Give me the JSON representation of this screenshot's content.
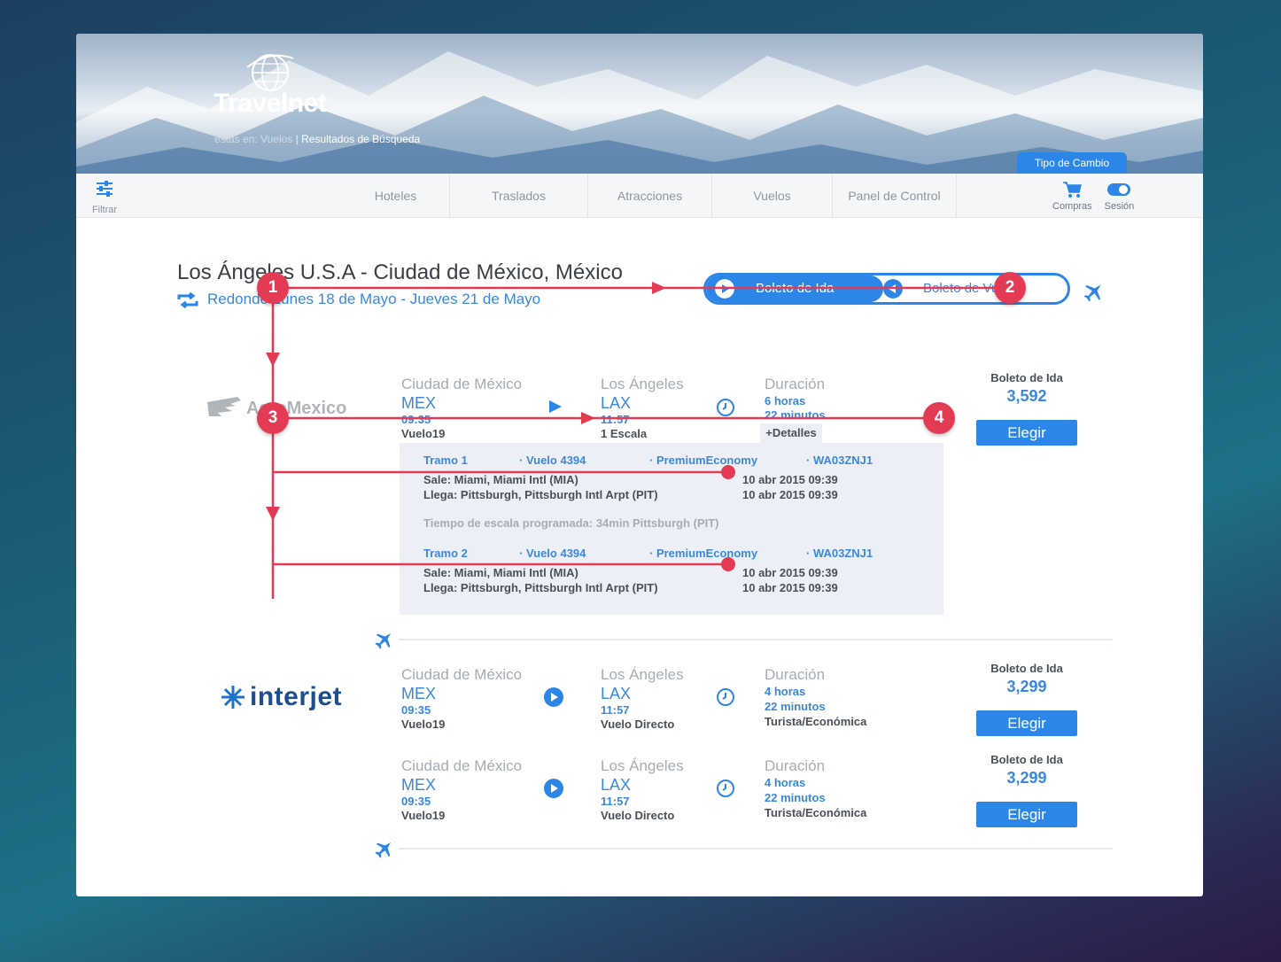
{
  "brand": {
    "name": "Travelnet"
  },
  "breadcrumb": {
    "prefix": "estás en:",
    "section": "Vuelos",
    "separator": "|",
    "current": "Resultados de Búsqueda"
  },
  "exchange_tab": "Tipo de Cambio",
  "navbar": {
    "filter_label": "Filtrar",
    "items": [
      "Hoteles",
      "Traslados",
      "Atracciones",
      "Vuelos",
      "Panel de Control"
    ],
    "cart_label": "Compras",
    "session_label": "Sesión"
  },
  "route": {
    "title": "Los Ángeles U.S.A - Ciudad de México, México",
    "subtitle": "Redondo Lunes 18 de Mayo - Jueves 21 de Mayo"
  },
  "ticket_toggle": {
    "outbound": "Boleto de Ida",
    "return": "Boleto de Vuelta"
  },
  "results": [
    {
      "airline": "AeroMexico",
      "origin_city": "Ciudad de México",
      "origin_code": "MEX",
      "depart_time": "09:35",
      "flight": "Vuelo19",
      "dest_city": "Los Ángeles",
      "dest_code": "LAX",
      "arrive_time": "11:57",
      "stops": "1 Escala",
      "duration_label": "Duración",
      "duration_hours": "6 horas",
      "duration_minutes": "22 minutos",
      "details_label": "+Detalles",
      "price_label": "Boleto de Ida",
      "price": "3,592",
      "choose": "Elegir"
    }
  ],
  "details": {
    "segments": [
      {
        "tramo": "Tramo 1",
        "vuelo": "· Vuelo 4394",
        "clase": "· PremiumEconomy",
        "codigo": "· WA03ZNJ1",
        "sale": "Sale: Miami, Miami Intl (MIA)",
        "llega": "Llega: Pittsburgh, Pittsburgh Intl Arpt (PIT)",
        "sale_fecha": "10 abr 2015 09:39",
        "llega_fecha": "10 abr 2015 09:39"
      },
      {
        "tramo": "Tramo 2",
        "vuelo": "· Vuelo 4394",
        "clase": "· PremiumEconomy",
        "codigo": "· WA03ZNJ1",
        "sale": "Sale: Miami, Miami Intl (MIA)",
        "llega": "Llega: Pittsburgh, Pittsburgh Intl Arpt (PIT)",
        "sale_fecha": "10 abr 2015 09:39",
        "llega_fecha": "10 abr 2015 09:39"
      }
    ],
    "layover": "Tiempo de escala programada: 34min  Pittsburgh (PIT)"
  },
  "interjet": {
    "airline": "interjet",
    "rows": [
      {
        "origin_city": "Ciudad de México",
        "origin_code": "MEX",
        "depart_time": "09:35",
        "flight": "Vuelo19",
        "dest_city": "Los Ángeles",
        "dest_code": "LAX",
        "arrive_time": "11:57",
        "stops": "Vuelo Directo",
        "duration_label": "Duración",
        "duration_hours": "4 horas",
        "duration_minutes": "22 minutos",
        "cabin": "Turista/Económica",
        "price_label": "Boleto de Ida",
        "price": "3,299",
        "choose": "Elegir"
      },
      {
        "origin_city": "Ciudad de México",
        "origin_code": "MEX",
        "depart_time": "09:35",
        "flight": "Vuelo19",
        "dest_city": "Los Ángeles",
        "dest_code": "LAX",
        "arrive_time": "11:57",
        "stops": "Vuelo Directo",
        "duration_label": "Duración",
        "duration_hours": "4 horas",
        "duration_minutes": "22 minutos",
        "cabin": "Turista/Económica",
        "price_label": "Boleto de Ida",
        "price": "3,299",
        "choose": "Elegir"
      }
    ]
  },
  "annotations": [
    "1",
    "2",
    "3",
    "4"
  ],
  "colors": {
    "accent": "#2b86e8",
    "annotation": "#e23b53",
    "text": "#4a5058",
    "muted": "#a5acb4"
  }
}
